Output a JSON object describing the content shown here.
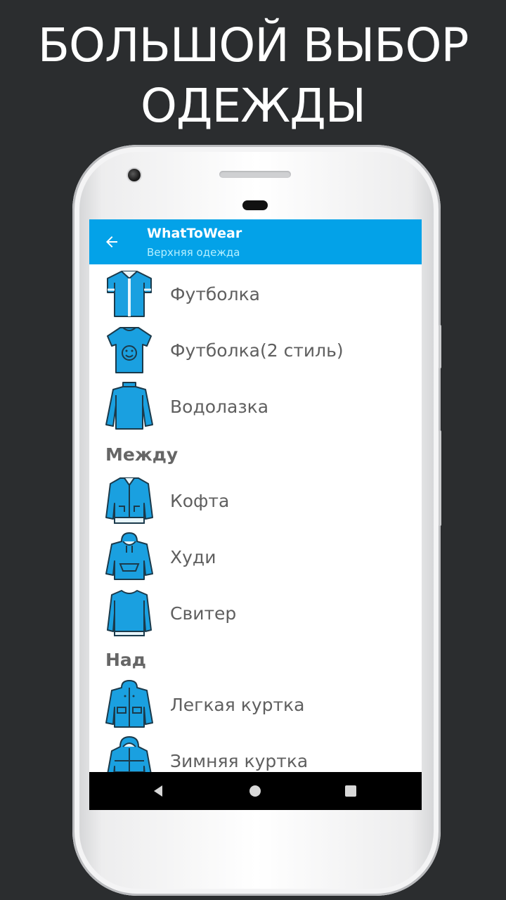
{
  "promo": {
    "line1": "БОЛЬШОЙ ВЫБОР",
    "line2": "ОДЕЖДЫ"
  },
  "app": {
    "title": "WhatToWear",
    "subtitle": "Верхняя одежда",
    "accent_color": "#03a2e8",
    "icon_color": "#1aa0e0"
  },
  "list": {
    "items": [
      {
        "label": "Футболка",
        "icon": "polo-shirt-icon"
      },
      {
        "label": "Футболка(2 стиль)",
        "icon": "smiley-tshirt-icon"
      },
      {
        "label": "Водолазка",
        "icon": "turtleneck-icon"
      }
    ],
    "section_between": "Между",
    "between_items": [
      {
        "label": "Кофта",
        "icon": "zip-jacket-icon"
      },
      {
        "label": "Худи",
        "icon": "hoodie-icon"
      },
      {
        "label": "Свитер",
        "icon": "sweater-icon"
      }
    ],
    "section_over": "Над",
    "over_items": [
      {
        "label": "Легкая куртка",
        "icon": "light-jacket-icon"
      },
      {
        "label": "Зимняя куртка",
        "icon": "winter-jacket-icon"
      }
    ]
  },
  "navbar": {
    "back": "nav-back-icon",
    "home": "nav-home-icon",
    "recent": "nav-recents-icon"
  }
}
